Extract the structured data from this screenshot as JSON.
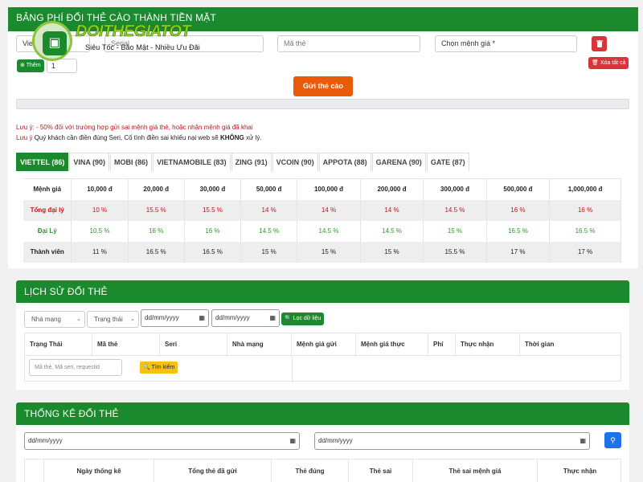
{
  "card1": {
    "title": "BẢNG PHÍ ĐỔI THẺ CÀO THÀNH TIỀN MẶT",
    "telco_value": "Viettel",
    "serial_placeholder": "Serial",
    "code_placeholder": "Mã thẻ",
    "amount_placeholder": "Chọn mệnh giá *",
    "delete_icon": "trash-icon",
    "delete_all_label": "Xóa tất cả",
    "add_label": "Thêm",
    "qty_value": "1",
    "submit_label": "Gửi thẻ cào",
    "notes": [
      {
        "label": "Lưu ý",
        "text": ": - 50% đối với trường hợp gửi sai mệnh giá thẻ, hoặc nhận mệnh giá đã khai"
      },
      {
        "label": "Lưu ý",
        "text_before": " Quý khách cần điền đúng Seri, Cố tình điền sai khiếu nại web sẽ ",
        "strong": "KHÔNG",
        "text_after": " xử lý."
      }
    ]
  },
  "logo": {
    "brand": "DOITHEGIATOT",
    "tagline": "Siêu Tốc - Bảo Mật - Nhiều Ưu Đãi"
  },
  "tabs": [
    {
      "label": "VIETTEL (86)",
      "active": true
    },
    {
      "label": "VINA (90)"
    },
    {
      "label": "MOBI (86)"
    },
    {
      "label": "VIETNAMOBILE (83)"
    },
    {
      "label": "ZING (91)"
    },
    {
      "label": "VCOIN (90)"
    },
    {
      "label": "APPOTA (88)"
    },
    {
      "label": "GARENA (90)"
    },
    {
      "label": "GATE (87)"
    }
  ],
  "rate_table": {
    "header_label": "Mệnh giá",
    "denominations": [
      "10,000 đ",
      "20,000 đ",
      "30,000 đ",
      "50,000 đ",
      "100,000 đ",
      "200,000 đ",
      "300,000 đ",
      "500,000 đ",
      "1,000,000 đ"
    ],
    "rows": [
      {
        "label": "Tổng đại lý",
        "values": [
          "10 %",
          "15.5 %",
          "15.5 %",
          "14 %",
          "14 %",
          "14 %",
          "14.5 %",
          "16 %",
          "16 %"
        ]
      },
      {
        "label": "Đại Lý",
        "values": [
          "10.5 %",
          "16 %",
          "16 %",
          "14.5 %",
          "14.5 %",
          "14.5 %",
          "15 %",
          "16.5 %",
          "16.5 %"
        ]
      },
      {
        "label": "Thành viên",
        "values": [
          "11 %",
          "16.5 %",
          "16.5 %",
          "15 %",
          "15 %",
          "15 %",
          "15.5 %",
          "17 %",
          "17 %"
        ]
      }
    ],
    "colors": {
      "tong_dai_ly": "#c4141a",
      "dai_ly": "#2e9a2e",
      "thanh_vien": "#222222"
    }
  },
  "history": {
    "title": "LỊCH SỬ ĐỔI THẺ",
    "network_select": "Nhà mạng",
    "status_select": "Trạng thái",
    "date_from": "dd/mm/yyyy",
    "date_to": "dd/mm/yyyy",
    "filter_label": "Lọc dữ liệu",
    "columns": [
      "Trạng Thái",
      "Mã thẻ",
      "Seri",
      "Nhà mạng",
      "Mệnh giá gửi",
      "Mệnh giá thực",
      "Phí",
      "Thực nhận",
      "Thời gian"
    ],
    "search_placeholder": "Mã thẻ, Mã seri, requestid",
    "search_label": "Tìm kiếm"
  },
  "stats": {
    "title": "THỐNG KÊ ĐỔI THẺ",
    "date_from": "dd/mm/yyyy",
    "date_to": "dd/mm/yyyy",
    "columns": [
      "Ngày thống kê",
      "Tổng thẻ đã gửi",
      "Thẻ đúng",
      "Thẻ sai",
      "Thẻ sai mệnh giá",
      "Thực nhận"
    ]
  },
  "theme": {
    "primary": "#1b8a2e",
    "danger": "#d9343b",
    "warning": "#f5c30f",
    "submit": "#ea5a0b",
    "blue": "#1a73e8"
  }
}
